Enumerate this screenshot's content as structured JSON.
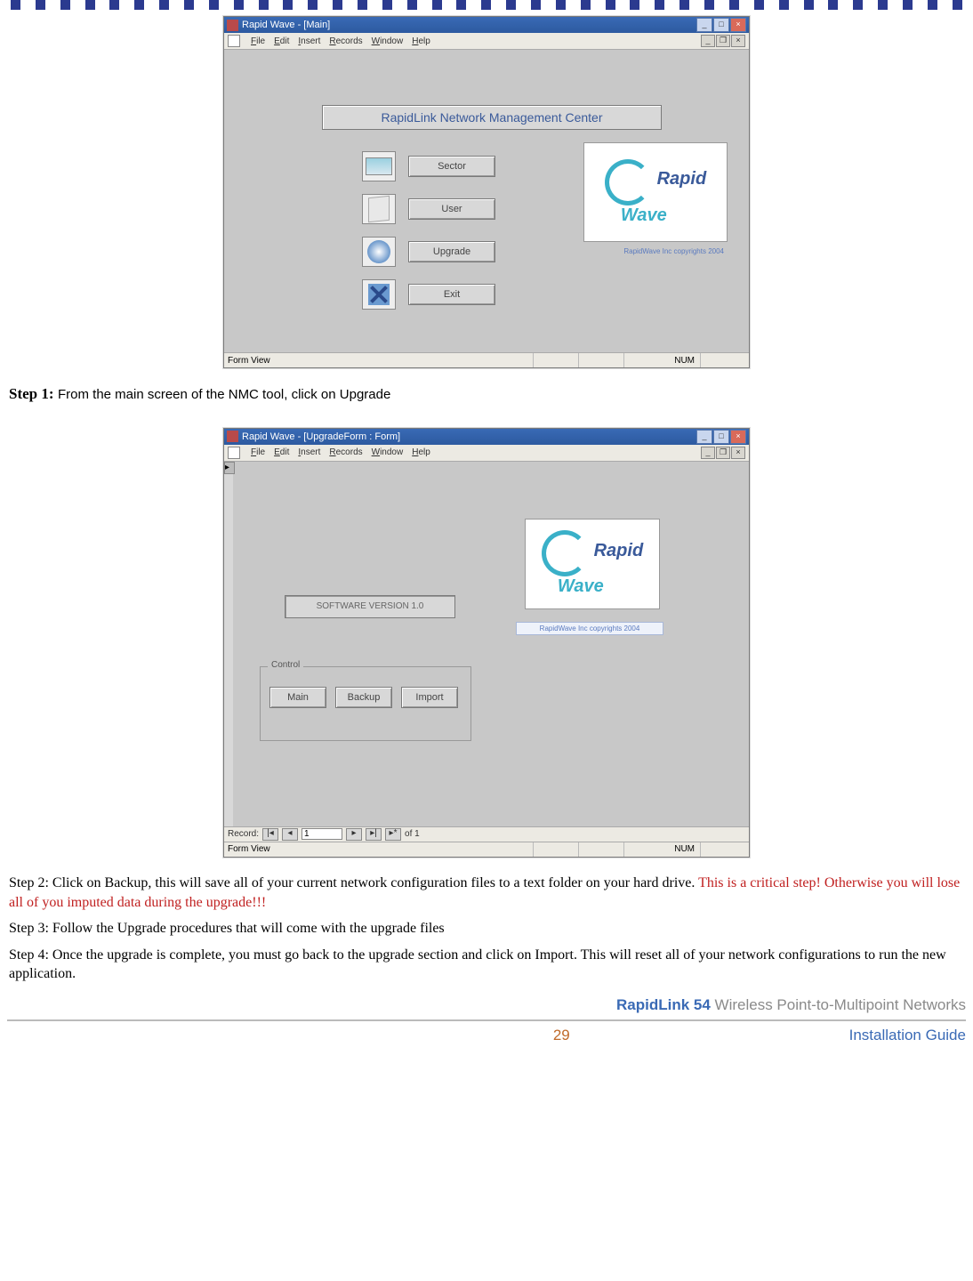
{
  "screenshot1": {
    "title": "Rapid Wave - [Main]",
    "menus": {
      "file": "File",
      "edit": "Edit",
      "insert": "Insert",
      "records": "Records",
      "window": "Window",
      "help": "Help"
    },
    "banner": "RapidLink Network Management Center",
    "buttons": {
      "sector": "Sector",
      "user": "User",
      "upgrade": "Upgrade",
      "exit": "Exit"
    },
    "logo": {
      "line1": "Rapid",
      "line2": "Wave"
    },
    "copyright": "RapidWave Inc copyrights 2004",
    "status_left": "Form View",
    "status_num": "NUM"
  },
  "step1": {
    "label": "Step 1:",
    "text": "From the main screen of the NMC tool, click on Upgrade"
  },
  "screenshot2": {
    "title": "Rapid Wave - [UpgradeForm : Form]",
    "menus": {
      "file": "File",
      "edit": "Edit",
      "insert": "Insert",
      "records": "Records",
      "window": "Window",
      "help": "Help"
    },
    "software_version": "SOFTWARE VERSION 1.0",
    "control_legend": "Control",
    "buttons": {
      "main": "Main",
      "backup": "Backup",
      "import": "Import"
    },
    "logo": {
      "line1": "Rapid",
      "line2": "Wave"
    },
    "copyright": "RapidWave Inc copyrights 2004",
    "record_label": "Record:",
    "record_value": "1",
    "record_of": "of  1",
    "status_left": "Form View",
    "status_num": "NUM"
  },
  "step2": {
    "text_a": "Step 2: Click on Backup, this will save all of your current network configuration files to a text folder on your hard drive.  ",
    "text_b": "This is a critical step! Otherwise you will lose all of you imputed data during the upgrade!!!"
  },
  "step3": "Step 3: Follow the Upgrade procedures that will come with the upgrade files",
  "step4": "Step 4: Once the upgrade is complete, you must go back to the upgrade section and click on Import.  This will reset all of your network configurations to run the new application.",
  "footer": {
    "brand_bold": "RapidLink 54 ",
    "brand_rest": "Wireless Point-to-Multipoint Networks",
    "page": "29",
    "guide": "Installation Guide"
  }
}
